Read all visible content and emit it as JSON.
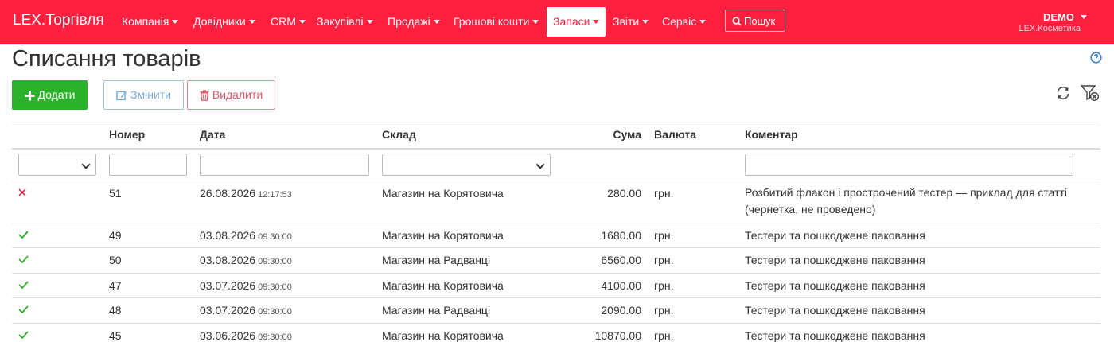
{
  "navbar": {
    "brand": "LEX.Торгівля",
    "items": [
      {
        "label": "Компанія"
      },
      {
        "label": "Довідники"
      },
      {
        "label": "CRM"
      },
      {
        "label": "Закупівлі"
      },
      {
        "label": "Продажі"
      },
      {
        "label": "Грошові кошти"
      },
      {
        "label": "Запаси",
        "active": true
      },
      {
        "label": "Звіти"
      },
      {
        "label": "Сервіс"
      }
    ],
    "search_label": "Пошук",
    "user": "DEMO",
    "company": "LEX.Косметика"
  },
  "page": {
    "title": "Списання товарів"
  },
  "toolbar": {
    "add_label": "Додати",
    "edit_label": "Змінити",
    "delete_label": "Видалити"
  },
  "table": {
    "headers": {
      "number": "Номер",
      "date": "Дата",
      "warehouse": "Склад",
      "sum": "Сума",
      "currency": "Валюта",
      "comment": "Коментар"
    },
    "rows": [
      {
        "status": "draft",
        "number": "51",
        "date": "26.08.2026",
        "time": "12:17:53",
        "warehouse": "Магазин на Корятовича",
        "sum": "280.00",
        "currency": "грн.",
        "comment": "Розбитий флакон і прострочений тестер — приклад для статті (чернетка, не проведено)"
      },
      {
        "status": "posted",
        "number": "49",
        "date": "03.08.2026",
        "time": "09:30:00",
        "warehouse": "Магазин на Корятовича",
        "sum": "1680.00",
        "currency": "грн.",
        "comment": "Тестери та пошкоджене паковання"
      },
      {
        "status": "posted",
        "number": "50",
        "date": "03.08.2026",
        "time": "09:30:00",
        "warehouse": "Магазин на Радванці",
        "sum": "6560.00",
        "currency": "грн.",
        "comment": "Тестери та пошкоджене паковання"
      },
      {
        "status": "posted",
        "number": "47",
        "date": "03.07.2026",
        "time": "09:30:00",
        "warehouse": "Магазин на Корятовича",
        "sum": "4100.00",
        "currency": "грн.",
        "comment": "Тестери та пошкоджене паковання"
      },
      {
        "status": "posted",
        "number": "48",
        "date": "03.07.2026",
        "time": "09:30:00",
        "warehouse": "Магазин на Радванці",
        "sum": "2090.00",
        "currency": "грн.",
        "comment": "Тестери та пошкоджене паковання"
      },
      {
        "status": "posted",
        "number": "45",
        "date": "03.06.2026",
        "time": "09:30:00",
        "warehouse": "Магазин на Корятовича",
        "sum": "10870.00",
        "currency": "грн.",
        "comment": "Тестери та пошкоджене паковання"
      }
    ]
  },
  "colors": {
    "brand": "#ff1f3f",
    "success": "#2bb12b",
    "danger": "#e0284a"
  },
  "icons": {
    "search": "search-icon",
    "help": "help-icon",
    "add": "plus-icon",
    "edit": "edit-icon",
    "delete": "trash-icon",
    "refresh": "refresh-icon",
    "filter_clear": "filter-clear-icon",
    "draft": "cross-icon",
    "posted": "check-icon"
  }
}
